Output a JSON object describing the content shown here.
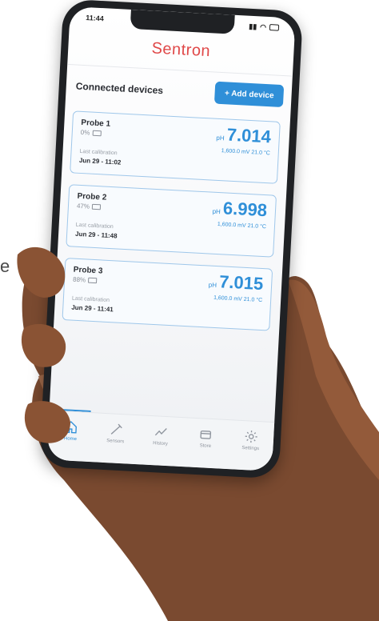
{
  "page": {
    "side_letter": "e"
  },
  "status_bar": {
    "time": "11:44"
  },
  "app": {
    "title": "Sentron"
  },
  "section": {
    "title": "Connected devices",
    "add_button": "+ Add device"
  },
  "devices": [
    {
      "name": "Probe 1",
      "battery": "0%",
      "ph_unit": "pH",
      "ph_value": "7.014",
      "sub": "1,600.0 mV 21.0 °C",
      "cal_label": "Last calibration",
      "cal_date": "Jun 29 - 11:02"
    },
    {
      "name": "Probe 2",
      "battery": "47%",
      "ph_unit": "pH",
      "ph_value": "6.998",
      "sub": "1,600.0 mV 21.0 °C",
      "cal_label": "Last calibration",
      "cal_date": "Jun 29 - 11:48"
    },
    {
      "name": "Probe 3",
      "battery": "88%",
      "ph_unit": "pH",
      "ph_value": "7.015",
      "sub": "1,600.0 mV 21.0 °C",
      "cal_label": "Last calibration",
      "cal_date": "Jun 29 - 11:41"
    }
  ],
  "tabs": [
    {
      "label": "Home",
      "icon": "home-icon",
      "active": true
    },
    {
      "label": "Sensors",
      "icon": "probe-icon",
      "active": false
    },
    {
      "label": "History",
      "icon": "chart-icon",
      "active": false
    },
    {
      "label": "Store",
      "icon": "store-icon",
      "active": false
    },
    {
      "label": "Settings",
      "icon": "gear-icon",
      "active": false
    }
  ],
  "colors": {
    "accent": "#2f8fd8",
    "brand": "#e04848"
  }
}
